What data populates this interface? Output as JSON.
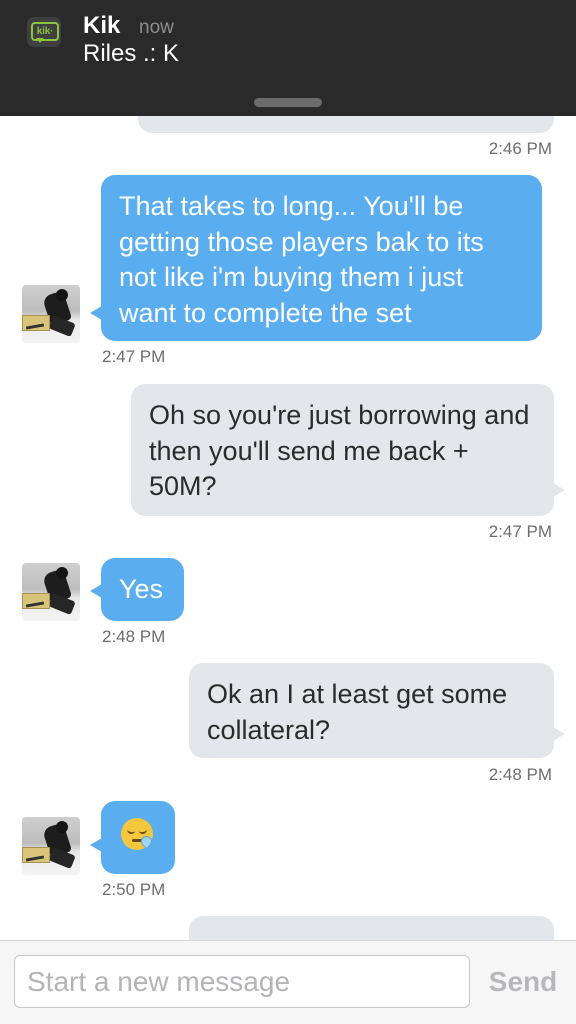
{
  "notification": {
    "app": "Kik",
    "time": "now",
    "message": "Riles .: K",
    "logo_text": "kik·"
  },
  "conversation": {
    "partial_top_time": "2:46 PM",
    "messages": [
      {
        "direction": "incoming",
        "text": "That takes to long... You'll be getting those players bak to its not like i'm buying them i just want to complete the set",
        "time": "2:47 PM"
      },
      {
        "direction": "outgoing",
        "text": "Oh so you're just borrowing and then you'll send me back + 50M?",
        "time": "2:47 PM"
      },
      {
        "direction": "incoming",
        "text": "Yes",
        "time": "2:48 PM"
      },
      {
        "direction": "outgoing",
        "text": "Ok an I at least get some collateral?",
        "time": "2:48 PM"
      },
      {
        "direction": "incoming",
        "emoji": "sleepy-face-emoji",
        "time": "2:50 PM"
      }
    ]
  },
  "composer": {
    "placeholder": "Start a new message",
    "value": "",
    "send_label": "Send"
  },
  "colors": {
    "incoming_bubble": "#5aaef0",
    "outgoing_bubble": "#e3e7ec",
    "banner": "#2a2a2a",
    "kik_green": "#8bc540"
  }
}
